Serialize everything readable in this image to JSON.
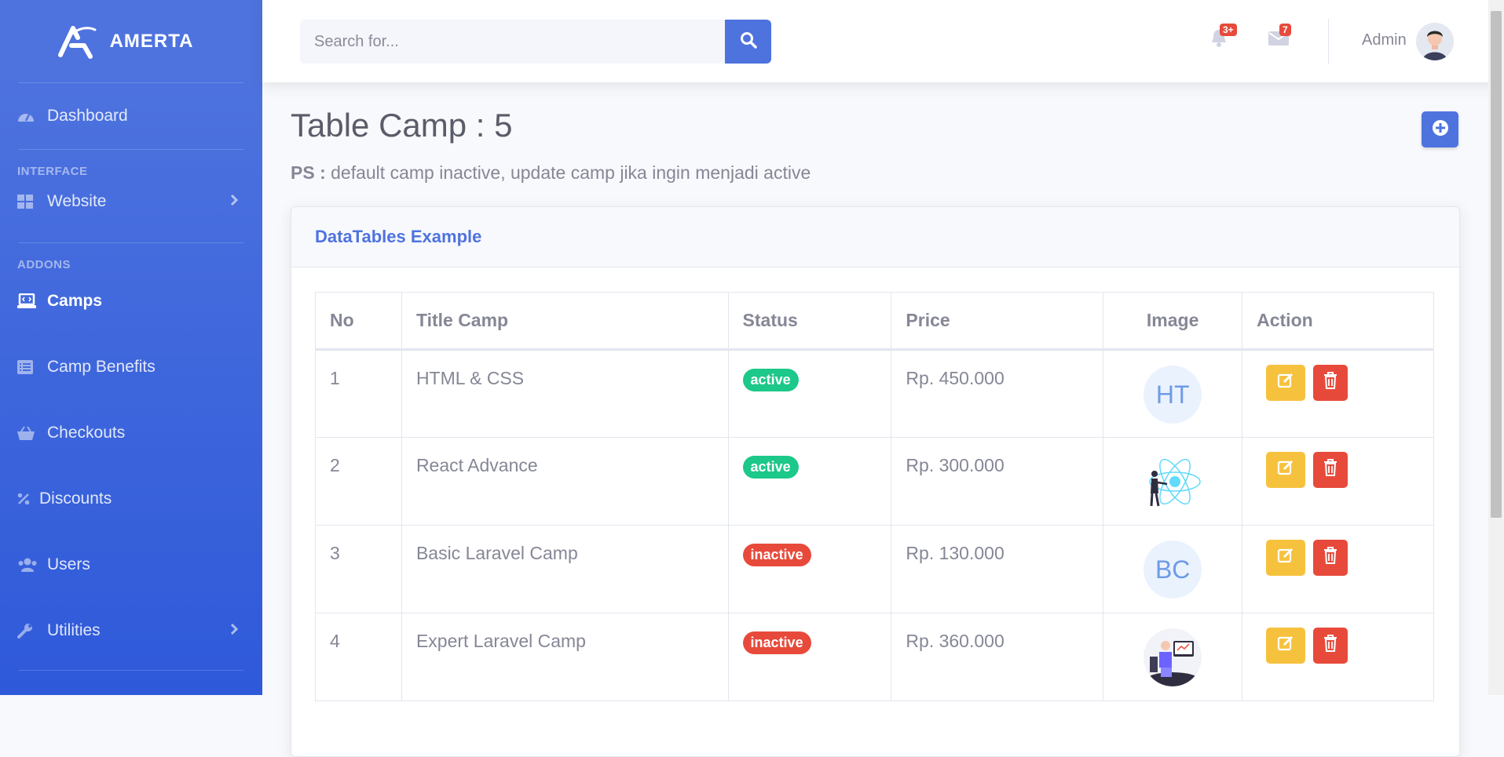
{
  "brand": {
    "name": "AMERTA",
    "icon": "laugh-wink-logo-icon"
  },
  "sidebar": {
    "dashboard": "Dashboard",
    "heading_interface": "INTERFACE",
    "website": "Website",
    "heading_addons": "ADDONS",
    "camps": "Camps",
    "camp_benefits": "Camp Benefits",
    "checkouts": "Checkouts",
    "discounts": "Discounts",
    "users": "Users",
    "utilities": "Utilities"
  },
  "topbar": {
    "search_placeholder": "Search for...",
    "alerts_count": "3+",
    "messages_count": "7",
    "user_name": "Admin"
  },
  "page": {
    "title": "Table Camp : 5",
    "note_label": "PS :",
    "note_text": " default camp inactive, update camp jika ingin menjadi active"
  },
  "card": {
    "title": "DataTables Example",
    "columns": [
      "No",
      "Title Camp",
      "Status",
      "Price",
      "Image",
      "Action"
    ],
    "rows": [
      {
        "no": "1",
        "title": "HTML & CSS",
        "status": "active",
        "price": "Rp. 450.000",
        "image": "HT"
      },
      {
        "no": "2",
        "title": "React Advance",
        "status": "active",
        "price": "Rp. 300.000",
        "image": "react-illustration"
      },
      {
        "no": "3",
        "title": "Basic Laravel Camp",
        "status": "inactive",
        "price": "Rp. 130.000",
        "image": "BC"
      },
      {
        "no": "4",
        "title": "Expert Laravel Camp",
        "status": "inactive",
        "price": "Rp. 360.000",
        "image": "developer-illustration"
      }
    ]
  },
  "colors": {
    "primary": "#4e73df",
    "active": "#1cc88a",
    "inactive": "#e74a3b",
    "warning": "#f6c23e",
    "danger": "#e74a3b"
  }
}
